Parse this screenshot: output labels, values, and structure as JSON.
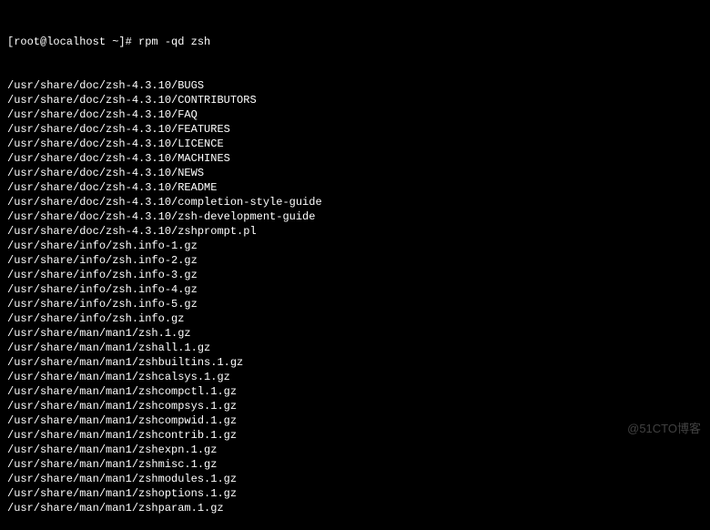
{
  "prompt": "[root@localhost ~]# ",
  "command": "rpm -qd zsh",
  "output": [
    "/usr/share/doc/zsh-4.3.10/BUGS",
    "/usr/share/doc/zsh-4.3.10/CONTRIBUTORS",
    "/usr/share/doc/zsh-4.3.10/FAQ",
    "/usr/share/doc/zsh-4.3.10/FEATURES",
    "/usr/share/doc/zsh-4.3.10/LICENCE",
    "/usr/share/doc/zsh-4.3.10/MACHINES",
    "/usr/share/doc/zsh-4.3.10/NEWS",
    "/usr/share/doc/zsh-4.3.10/README",
    "/usr/share/doc/zsh-4.3.10/completion-style-guide",
    "/usr/share/doc/zsh-4.3.10/zsh-development-guide",
    "/usr/share/doc/zsh-4.3.10/zshprompt.pl",
    "/usr/share/info/zsh.info-1.gz",
    "/usr/share/info/zsh.info-2.gz",
    "/usr/share/info/zsh.info-3.gz",
    "/usr/share/info/zsh.info-4.gz",
    "/usr/share/info/zsh.info-5.gz",
    "/usr/share/info/zsh.info.gz",
    "/usr/share/man/man1/zsh.1.gz",
    "/usr/share/man/man1/zshall.1.gz",
    "/usr/share/man/man1/zshbuiltins.1.gz",
    "/usr/share/man/man1/zshcalsys.1.gz",
    "/usr/share/man/man1/zshcompctl.1.gz",
    "/usr/share/man/man1/zshcompsys.1.gz",
    "/usr/share/man/man1/zshcompwid.1.gz",
    "/usr/share/man/man1/zshcontrib.1.gz",
    "/usr/share/man/man1/zshexpn.1.gz",
    "/usr/share/man/man1/zshmisc.1.gz",
    "/usr/share/man/man1/zshmodules.1.gz",
    "/usr/share/man/man1/zshoptions.1.gz",
    "/usr/share/man/man1/zshparam.1.gz"
  ],
  "watermark": "@51CTO博客"
}
